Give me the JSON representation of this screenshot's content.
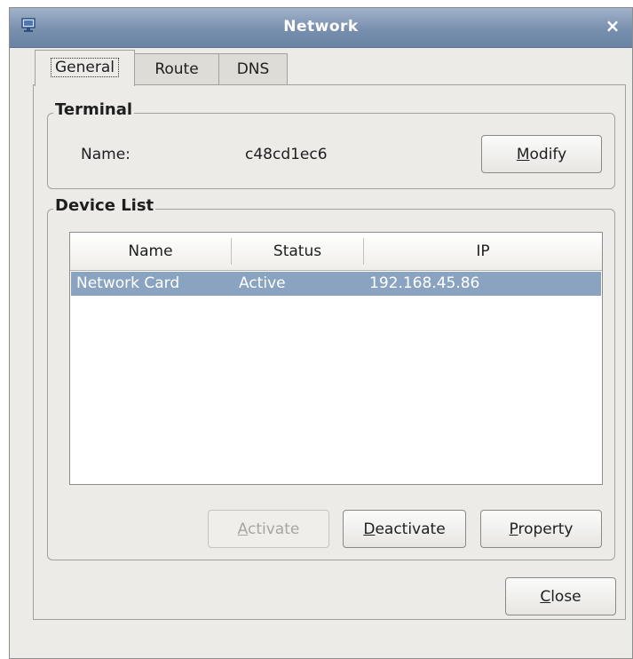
{
  "window": {
    "title": "Network",
    "close_glyph": "×",
    "icon": "network-icon"
  },
  "tabs": [
    {
      "label": "General",
      "active": true
    },
    {
      "label": "Route",
      "active": false
    },
    {
      "label": "DNS",
      "active": false
    }
  ],
  "terminal": {
    "legend": "Terminal",
    "name_label": "Name:",
    "name_value": "c48cd1ec6",
    "modify_mnemonic": "M",
    "modify_rest": "odify"
  },
  "device_list": {
    "legend": "Device List",
    "columns": [
      "Name",
      "Status",
      "IP"
    ],
    "rows": [
      {
        "name": "Network Card",
        "status": "Active",
        "ip": "192.168.45.86",
        "selected": true
      }
    ],
    "activate_mnemonic": "A",
    "activate_rest": "ctivate",
    "deactivate_mnemonic": "D",
    "deactivate_rest": "eactivate",
    "property_mnemonic": "P",
    "property_rest": "roperty"
  },
  "footer": {
    "close_mnemonic": "C",
    "close_rest": "lose"
  },
  "colors": {
    "titlebar": "#788fae",
    "selection": "#8aa3c1",
    "window_bg": "#ecebe7"
  }
}
